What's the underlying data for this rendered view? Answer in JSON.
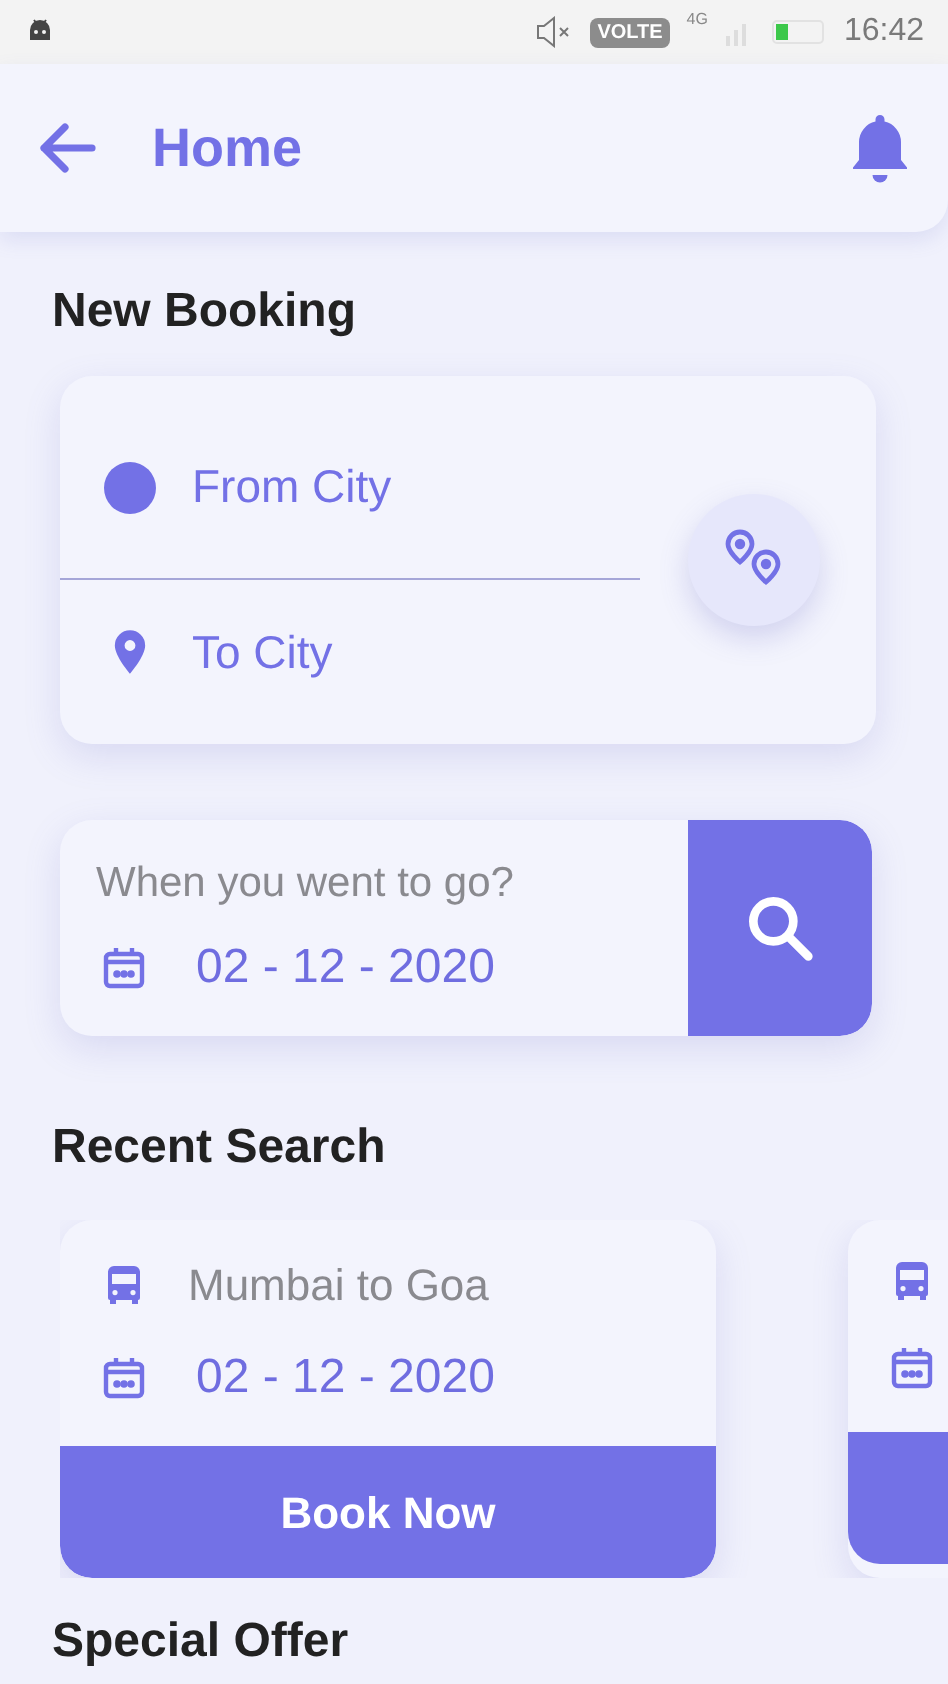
{
  "status_bar": {
    "network": "4G",
    "volte": "VOLTE",
    "time": "16:42"
  },
  "header": {
    "title": "Home"
  },
  "new_booking": {
    "title": "New Booking",
    "from": {
      "placeholder": "From City"
    },
    "to": {
      "placeholder": "To City"
    }
  },
  "date_search": {
    "label": "When you went to go?",
    "date": "02 - 12 - 2020"
  },
  "recent": {
    "title": "Recent Search",
    "items": [
      {
        "kind": "card",
        "route": "Mumbai to Goa",
        "date": "02 - 12 - 2020",
        "button": "Book Now"
      },
      {
        "kind": "peek"
      }
    ]
  },
  "special_offer": {
    "title": "Special Offer"
  }
}
